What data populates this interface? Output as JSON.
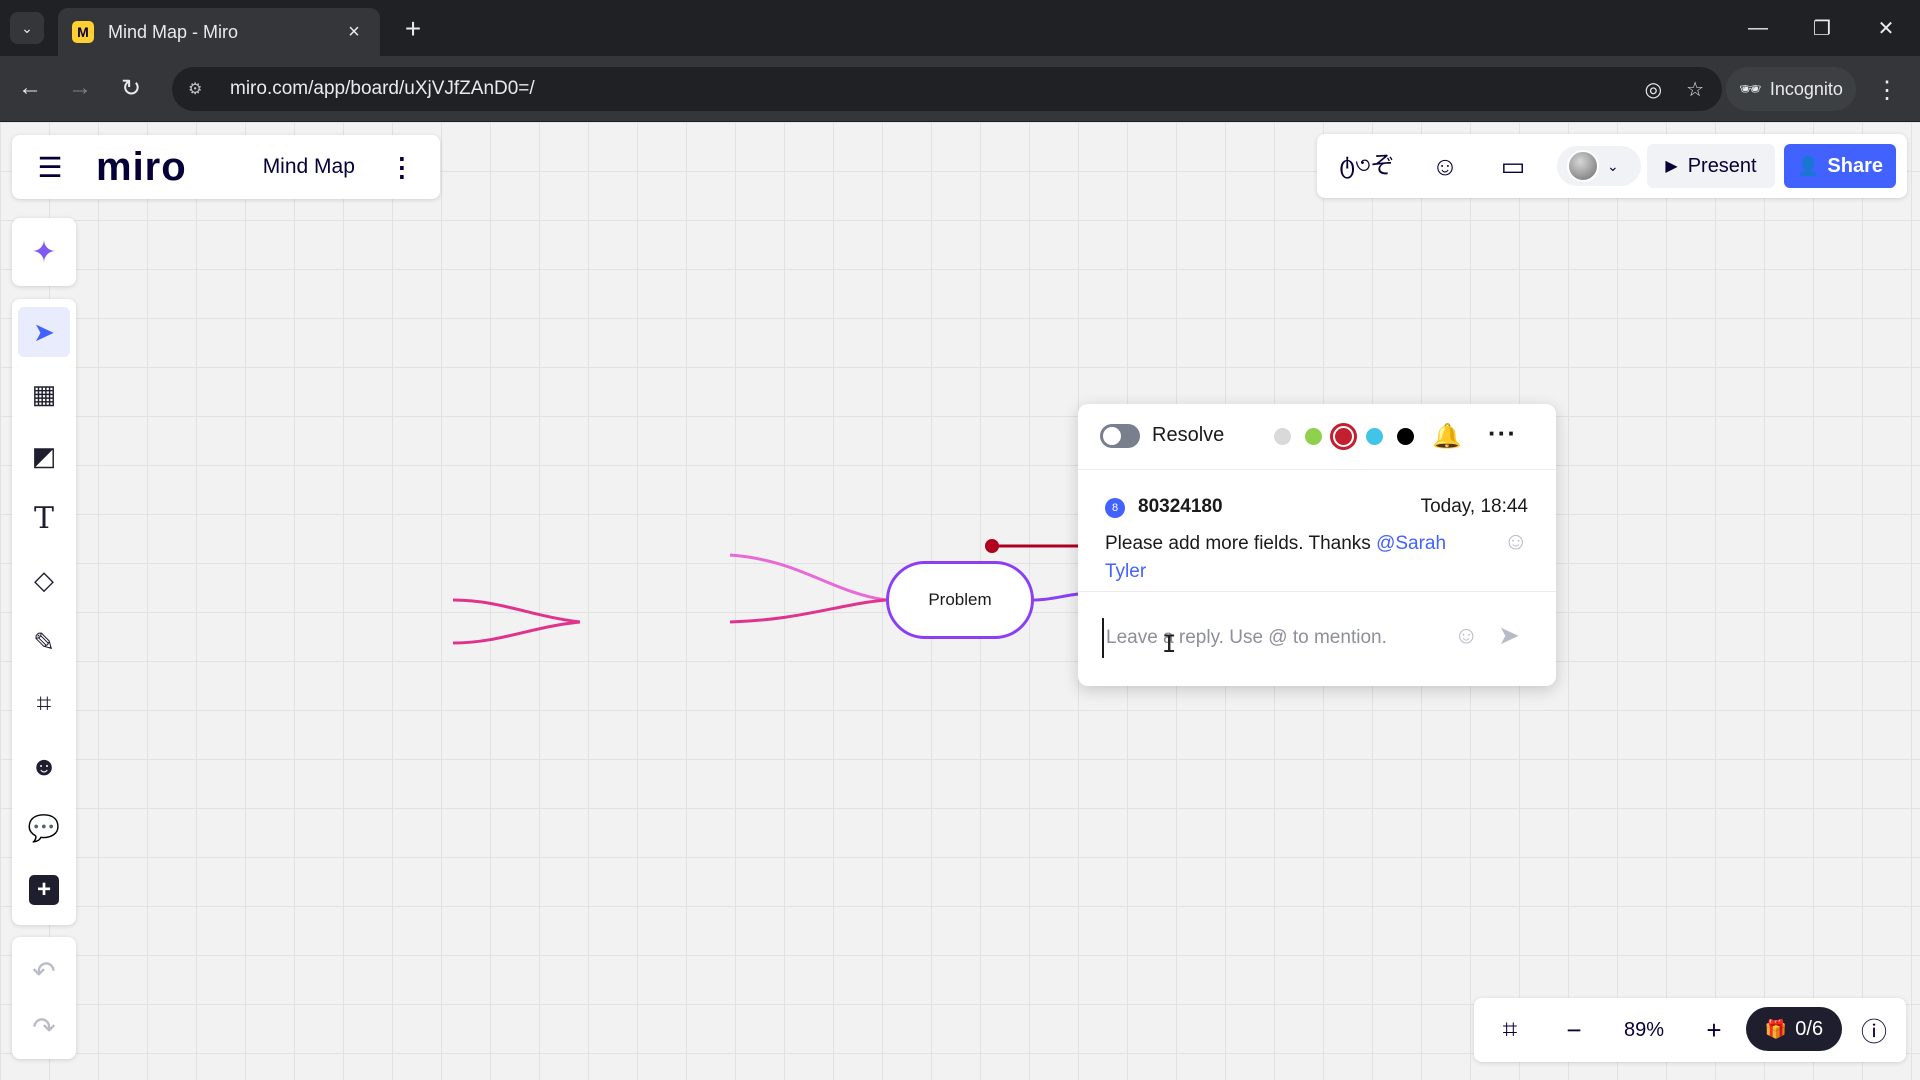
{
  "browser": {
    "tab_title": "Mind Map - Miro",
    "favicon_text": "M",
    "url": "miro.com/app/board/uXjVJfZAnD0=/",
    "incognito_label": "Incognito"
  },
  "board": {
    "logo": "miro",
    "name": "Mind Map"
  },
  "header": {
    "present_label": "Present",
    "share_label": "Share"
  },
  "toolbar": {
    "tools": [
      "select",
      "templates",
      "sticky-note",
      "text",
      "shapes",
      "pen",
      "frame",
      "stickers",
      "comment",
      "more"
    ],
    "active_tool": "select"
  },
  "mindmap": {
    "center_node": "Problem",
    "branch_colors": [
      "#e0338e",
      "#e86ad6",
      "#8a3ef7",
      "#b00020"
    ]
  },
  "comment": {
    "resolve_label": "Resolve",
    "colors": [
      "#d9d9d9",
      "#8fd14f",
      "#c31f2e",
      "#40c4e8",
      "#000000"
    ],
    "selected_color": "#c31f2e",
    "author_initial": "8",
    "author": "80324180",
    "time": "Today, 18:44",
    "text_before": "Please add more fields. Thanks ",
    "mention": "@Sarah Tyler",
    "reply_placeholder": "Leave a reply. Use @ to mention."
  },
  "zoom": {
    "level": "89%",
    "apps_count": "0/6"
  },
  "accent_color": "#4262ff"
}
